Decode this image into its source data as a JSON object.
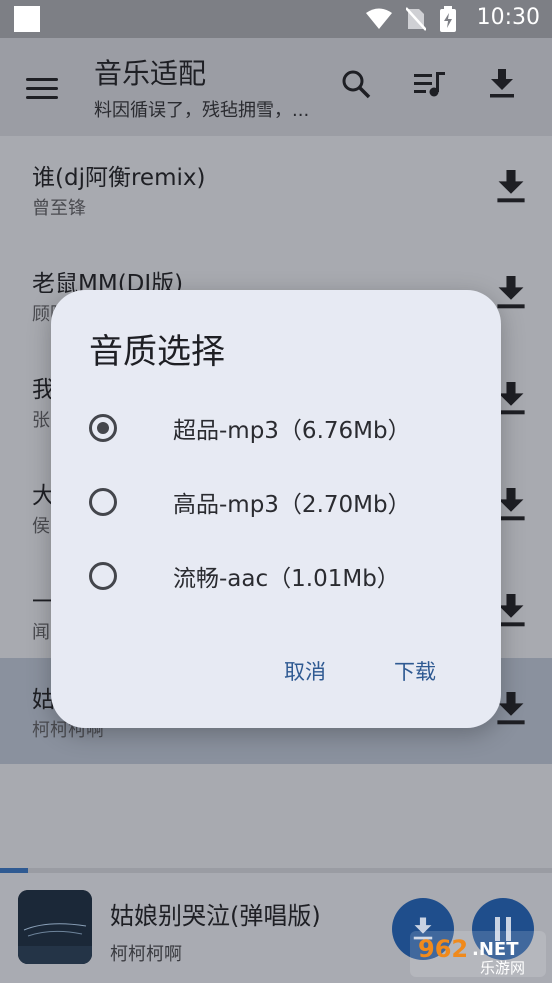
{
  "status_bar": {
    "time": "10:30"
  },
  "app_bar": {
    "title": "音乐适配",
    "subtitle": "料因循误了，残毡拥雪，..."
  },
  "songs": [
    {
      "title": "谁(dj阿衡remix)",
      "artist": "曾至锋"
    },
    {
      "title": "老鼠MM(DJ版)",
      "artist": "顾阿"
    },
    {
      "title": "我",
      "artist": "张"
    },
    {
      "title": "大",
      "artist": "侯"
    },
    {
      "title": "一",
      "artist": "闻"
    },
    {
      "title": "姑",
      "artist": "柯柯柯啊"
    }
  ],
  "dialog": {
    "title": "音质选择",
    "options": [
      {
        "label": "超品-mp3（6.76Mb）",
        "selected": true
      },
      {
        "label": "高品-mp3（2.70Mb）",
        "selected": false
      },
      {
        "label": "流畅-aac（1.01Mb）",
        "selected": false
      }
    ],
    "cancel": "取消",
    "confirm": "下载"
  },
  "player": {
    "title": "姑娘别哭泣(弹唱版)",
    "artist": "柯柯柯啊",
    "progress": 0.05
  },
  "watermark": "962.NET 乐游网",
  "colors": {
    "accent": "#2f5a92",
    "dialog_bg": "#e7eaf3"
  }
}
